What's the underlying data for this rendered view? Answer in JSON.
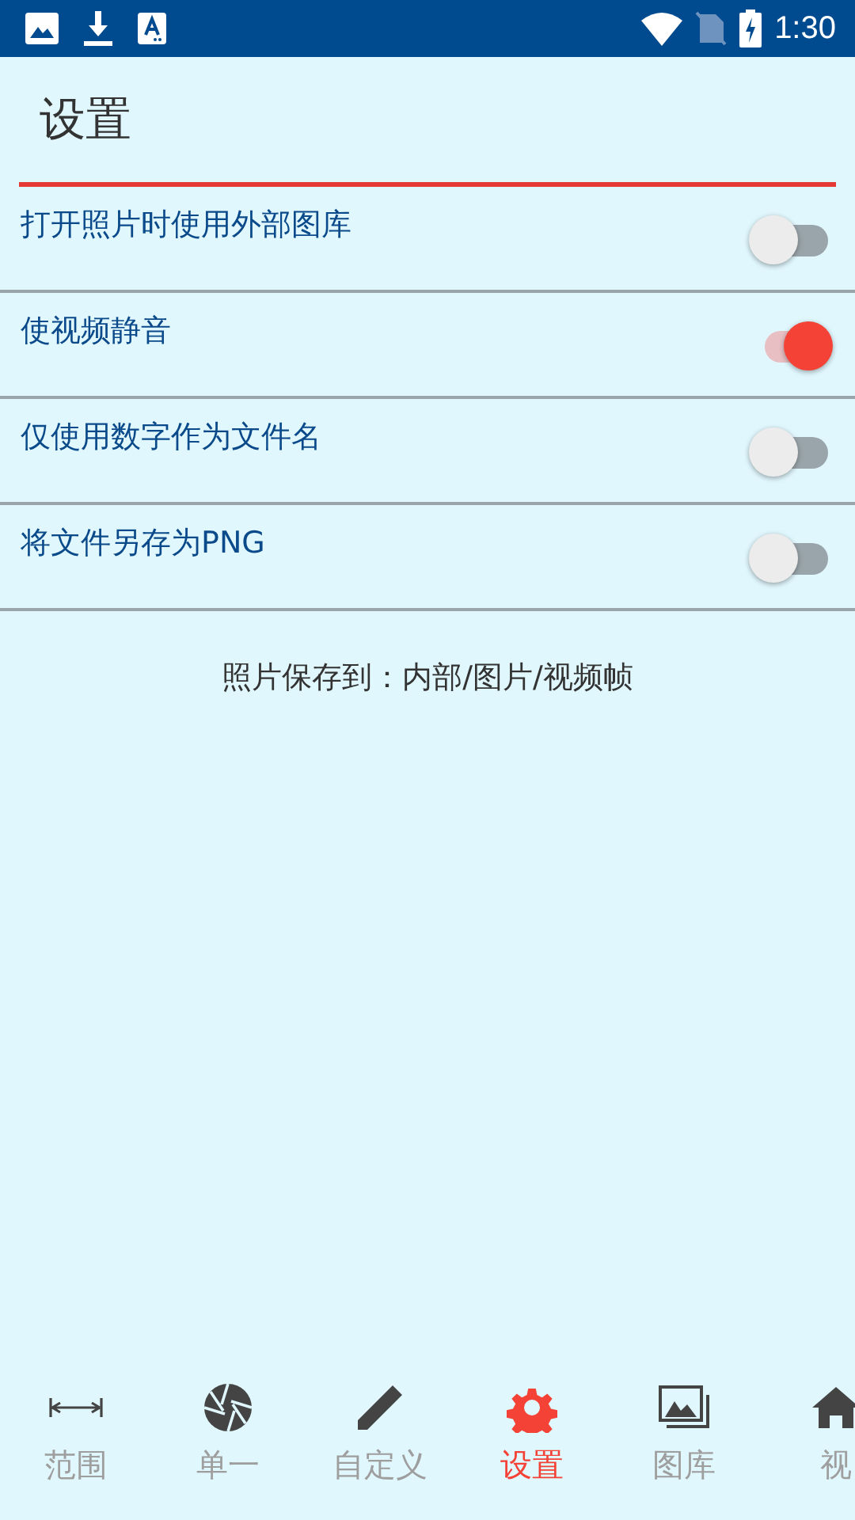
{
  "status_bar": {
    "time": "1:30"
  },
  "header": {
    "title": "设置"
  },
  "settings": [
    {
      "label": "打开照片时使用外部图库",
      "on": false
    },
    {
      "label": "使视频静音",
      "on": true
    },
    {
      "label": "仅使用数字作为文件名",
      "on": false
    },
    {
      "label": "将文件另存为PNG",
      "on": false
    }
  ],
  "save_path": "照片保存到：内部/图片/视频帧",
  "bottom_nav": [
    {
      "label": "范围",
      "kind": "range",
      "selected": false
    },
    {
      "label": "单一",
      "kind": "aperture",
      "selected": false
    },
    {
      "label": "自定义",
      "kind": "pencil",
      "selected": false
    },
    {
      "label": "设置",
      "kind": "gear",
      "selected": true
    },
    {
      "label": "图库",
      "kind": "gallery",
      "selected": false
    },
    {
      "label": "视",
      "kind": "home",
      "selected": false
    }
  ]
}
